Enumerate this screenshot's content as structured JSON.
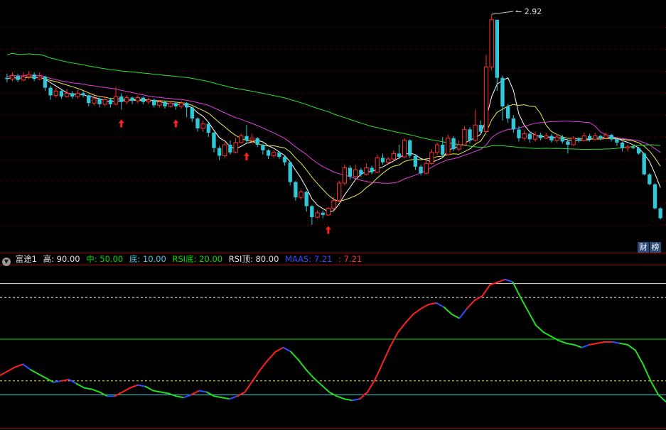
{
  "legend": {
    "indicator_name": "富途1",
    "items": [
      {
        "text": "高: 90.00",
        "color": "#e0e0e0"
      },
      {
        "text": "中: 50.00",
        "color": "#00e000"
      },
      {
        "text": "底: 10.00",
        "color": "#40d0e0"
      },
      {
        "text": "RSI底: 20.00",
        "color": "#00e000"
      },
      {
        "text": "RSI顶: 80.00",
        "color": "#e0e0e0"
      },
      {
        "text": "MAAS: 7.21",
        "color": "#3050ff"
      },
      {
        "text": ": 7.21",
        "color": "#ff3030"
      }
    ]
  },
  "side_buttons": [
    "财",
    "榜"
  ],
  "peak_label": "2.92",
  "colors": {
    "up": "#ff3030",
    "down": "#30c8d8",
    "ma_white": "#ffffff",
    "ma_yellow": "#e8e850",
    "ma_magenta": "#e040e0",
    "ma_green": "#30e030",
    "rsi_up": "#ff2020",
    "rsi_down": "#20e020",
    "rsi_turn": "#3050ff",
    "grid": "#7a0000"
  },
  "chart_data": [
    {
      "type": "candlestick",
      "price_range": [
        0.85,
        3.05
      ],
      "grid_levels": [
        2.8,
        2.6,
        2.4,
        2.2,
        2.0,
        1.8,
        1.6,
        1.4,
        1.2,
        1.0
      ],
      "peak_marker": 2.92,
      "signal_arrows": [
        21,
        31,
        44,
        59
      ],
      "candles": [
        [
          2.34,
          2.33,
          2.38,
          2.3
        ],
        [
          2.33,
          2.36,
          2.39,
          2.31
        ],
        [
          2.36,
          2.32,
          2.38,
          2.3
        ],
        [
          2.32,
          2.35,
          2.39,
          2.31
        ],
        [
          2.35,
          2.37,
          2.4,
          2.33
        ],
        [
          2.37,
          2.33,
          2.39,
          2.31
        ],
        [
          2.33,
          2.35,
          2.39,
          2.32
        ],
        [
          2.35,
          2.25,
          2.36,
          2.22
        ],
        [
          2.25,
          2.18,
          2.27,
          2.14
        ],
        [
          2.18,
          2.22,
          2.25,
          2.16
        ],
        [
          2.22,
          2.17,
          2.24,
          2.15
        ],
        [
          2.17,
          2.2,
          2.24,
          2.16
        ],
        [
          2.2,
          2.17,
          2.22,
          2.15
        ],
        [
          2.17,
          2.2,
          2.23,
          2.15
        ],
        [
          2.2,
          2.18,
          2.22,
          2.16
        ],
        [
          2.18,
          2.11,
          2.19,
          2.08
        ],
        [
          2.11,
          2.15,
          2.18,
          2.09
        ],
        [
          2.15,
          2.1,
          2.16,
          2.07
        ],
        [
          2.1,
          2.14,
          2.17,
          2.08
        ],
        [
          2.14,
          2.1,
          2.16,
          2.07
        ],
        [
          2.1,
          2.17,
          2.26,
          2.09
        ],
        [
          2.17,
          2.12,
          2.2,
          2.05
        ],
        [
          2.12,
          2.16,
          2.18,
          2.1
        ],
        [
          2.16,
          2.13,
          2.17,
          2.1
        ],
        [
          2.13,
          2.16,
          2.18,
          2.11
        ],
        [
          2.16,
          2.12,
          2.17,
          2.1
        ],
        [
          2.12,
          2.14,
          2.16,
          2.1
        ],
        [
          2.14,
          2.09,
          2.15,
          2.07
        ],
        [
          2.09,
          2.12,
          2.14,
          2.07
        ],
        [
          2.12,
          2.08,
          2.13,
          2.06
        ],
        [
          2.08,
          2.11,
          2.13,
          2.07
        ],
        [
          2.11,
          2.08,
          2.12,
          2.05
        ],
        [
          2.08,
          2.11,
          2.13,
          2.06
        ],
        [
          2.11,
          2.07,
          2.12,
          1.98
        ],
        [
          2.07,
          1.97,
          2.08,
          1.94
        ],
        [
          1.97,
          1.88,
          1.98,
          1.85
        ],
        [
          1.88,
          1.92,
          1.95,
          1.85
        ],
        [
          1.92,
          1.84,
          1.93,
          1.8
        ],
        [
          1.84,
          1.7,
          1.85,
          1.66
        ],
        [
          1.7,
          1.63,
          1.72,
          1.59
        ],
        [
          1.63,
          1.73,
          1.75,
          1.61
        ],
        [
          1.73,
          1.66,
          1.77,
          1.64
        ],
        [
          1.66,
          1.75,
          1.79,
          1.65
        ],
        [
          1.75,
          1.81,
          1.83,
          1.74
        ],
        [
          1.81,
          1.77,
          1.91,
          1.75
        ],
        [
          1.77,
          1.79,
          1.83,
          1.74
        ],
        [
          1.79,
          1.73,
          1.8,
          1.71
        ],
        [
          1.73,
          1.68,
          1.74,
          1.64
        ],
        [
          1.68,
          1.63,
          1.69,
          1.6
        ],
        [
          1.63,
          1.66,
          1.68,
          1.61
        ],
        [
          1.66,
          1.62,
          1.67,
          1.6
        ],
        [
          1.62,
          1.57,
          1.63,
          1.54
        ],
        [
          1.57,
          1.39,
          1.58,
          1.36
        ],
        [
          1.39,
          1.25,
          1.4,
          1.22
        ],
        [
          1.25,
          1.3,
          1.32,
          1.23
        ],
        [
          1.3,
          1.17,
          1.31,
          1.12
        ],
        [
          1.17,
          1.07,
          1.18,
          1.0
        ],
        [
          1.07,
          1.11,
          1.13,
          1.06
        ],
        [
          1.11,
          1.09,
          1.13,
          1.06
        ],
        [
          1.09,
          1.15,
          1.16,
          1.08
        ],
        [
          1.15,
          1.22,
          1.25,
          1.13
        ],
        [
          1.22,
          1.38,
          1.4,
          1.21
        ],
        [
          1.38,
          1.52,
          1.55,
          1.36
        ],
        [
          1.52,
          1.44,
          1.54,
          1.41
        ],
        [
          1.44,
          1.5,
          1.55,
          1.43
        ],
        [
          1.5,
          1.46,
          1.52,
          1.44
        ],
        [
          1.46,
          1.52,
          1.56,
          1.45
        ],
        [
          1.52,
          1.48,
          1.54,
          1.46
        ],
        [
          1.48,
          1.61,
          1.64,
          1.47
        ],
        [
          1.61,
          1.57,
          1.65,
          1.55
        ],
        [
          1.57,
          1.6,
          1.62,
          1.55
        ],
        [
          1.6,
          1.65,
          1.68,
          1.58
        ],
        [
          1.65,
          1.62,
          1.73,
          1.6
        ],
        [
          1.62,
          1.77,
          1.79,
          1.61
        ],
        [
          1.77,
          1.63,
          1.78,
          1.61
        ],
        [
          1.63,
          1.53,
          1.64,
          1.5
        ],
        [
          1.53,
          1.47,
          1.55,
          1.45
        ],
        [
          1.47,
          1.56,
          1.59,
          1.46
        ],
        [
          1.56,
          1.66,
          1.69,
          1.55
        ],
        [
          1.66,
          1.73,
          1.75,
          1.64
        ],
        [
          1.73,
          1.64,
          1.8,
          1.62
        ],
        [
          1.64,
          1.79,
          1.82,
          1.63
        ],
        [
          1.79,
          1.69,
          1.81,
          1.67
        ],
        [
          1.69,
          1.73,
          1.77,
          1.67
        ],
        [
          1.73,
          1.87,
          1.9,
          1.72
        ],
        [
          1.87,
          1.77,
          1.89,
          1.74
        ],
        [
          1.77,
          1.91,
          2.05,
          1.76
        ],
        [
          1.91,
          1.85,
          1.95,
          1.82
        ],
        [
          1.85,
          2.44,
          2.55,
          1.84
        ],
        [
          2.44,
          2.87,
          2.92,
          2.41
        ],
        [
          2.87,
          2.34,
          2.65,
          2.22
        ],
        [
          2.34,
          2.08,
          2.36,
          1.95
        ],
        [
          2.08,
          1.97,
          2.1,
          1.93
        ],
        [
          1.97,
          1.87,
          2.0,
          1.84
        ],
        [
          1.87,
          1.79,
          1.9,
          1.76
        ],
        [
          1.79,
          1.83,
          1.86,
          1.77
        ],
        [
          1.83,
          1.78,
          1.84,
          1.75
        ],
        [
          1.78,
          1.82,
          1.85,
          1.76
        ],
        [
          1.82,
          1.79,
          1.84,
          1.77
        ],
        [
          1.79,
          1.81,
          1.84,
          1.78
        ],
        [
          1.81,
          1.77,
          1.83,
          1.75
        ],
        [
          1.77,
          1.8,
          1.83,
          1.75
        ],
        [
          1.8,
          1.76,
          1.82,
          1.74
        ],
        [
          1.76,
          1.73,
          1.78,
          1.65
        ],
        [
          1.73,
          1.79,
          1.81,
          1.72
        ],
        [
          1.79,
          1.77,
          1.8,
          1.75
        ],
        [
          1.77,
          1.81,
          1.84,
          1.76
        ],
        [
          1.81,
          1.78,
          1.83,
          1.76
        ],
        [
          1.78,
          1.81,
          1.84,
          1.77
        ],
        [
          1.81,
          1.79,
          1.82,
          1.77
        ],
        [
          1.79,
          1.82,
          1.84,
          1.78
        ],
        [
          1.82,
          1.78,
          1.83,
          1.76
        ],
        [
          1.78,
          1.75,
          1.79,
          1.72
        ],
        [
          1.75,
          1.7,
          1.76,
          1.67
        ],
        [
          1.7,
          1.71,
          1.73,
          1.67
        ],
        [
          1.71,
          1.7,
          1.72,
          1.69
        ],
        [
          1.7,
          1.65,
          1.71,
          1.64
        ],
        [
          1.65,
          1.46,
          1.66,
          1.45
        ],
        [
          1.46,
          1.37,
          1.47,
          1.36
        ],
        [
          1.37,
          1.15,
          1.38,
          1.14
        ],
        [
          1.15,
          1.06,
          1.16,
          1.05
        ]
      ]
    },
    {
      "type": "line",
      "y_range": [
        0,
        100
      ],
      "levels": [
        {
          "value": 90,
          "color": "#e0e0e0",
          "style": "solid"
        },
        {
          "value": 80,
          "color": "#e0e0e0",
          "style": "dashed"
        },
        {
          "value": 50,
          "color": "#00e000",
          "style": "solid"
        },
        {
          "value": 20,
          "color": "#e8e850",
          "style": "dashed"
        },
        {
          "value": 10,
          "color": "#40d0e0",
          "style": "solid"
        }
      ],
      "values": [
        24,
        27,
        30,
        32,
        28,
        25,
        22,
        19,
        20,
        21,
        18,
        15,
        14,
        12,
        9,
        9,
        12,
        15,
        17,
        16,
        13,
        12,
        11,
        9,
        8,
        10,
        13,
        12,
        9,
        8,
        7,
        9,
        12,
        20,
        28,
        35,
        41,
        44,
        41,
        35,
        28,
        22,
        17,
        12,
        9,
        7,
        6,
        7,
        12,
        21,
        33,
        45,
        55,
        62,
        68,
        72,
        75,
        76,
        73,
        68,
        65,
        72,
        78,
        81,
        89,
        91,
        93,
        91,
        80,
        70,
        60,
        55,
        52,
        49,
        47,
        46,
        44,
        46,
        47,
        48,
        48,
        47,
        46,
        42,
        32,
        20,
        10,
        5
      ]
    }
  ]
}
